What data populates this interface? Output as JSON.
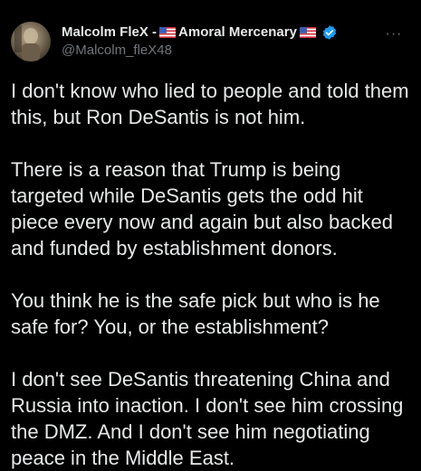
{
  "author": {
    "display_name_prefix": "Malcolm FleX -",
    "display_name_middle": "Amoral Mercenary",
    "handle": "@Malcolm_fleX48",
    "more_glyph": "···",
    "verified_color": "#1d9bf0"
  },
  "tweet": {
    "paragraphs": [
      "I don't know who lied to people and told them this, but Ron DeSantis is not him.",
      "There is a reason that Trump is being targeted while DeSantis gets the odd hit piece every now and again but also backed and funded by establishment donors.",
      "You think he is the safe pick but who is he safe for? You, or the establishment?",
      "I don't see DeSantis threatening China and Russia into inaction. I don't see him crossing the DMZ. And I don't see him negotiating peace in the Middle East."
    ]
  },
  "colors": {
    "background": "#000000",
    "text": "#e7e9ea",
    "muted": "#71767b"
  }
}
